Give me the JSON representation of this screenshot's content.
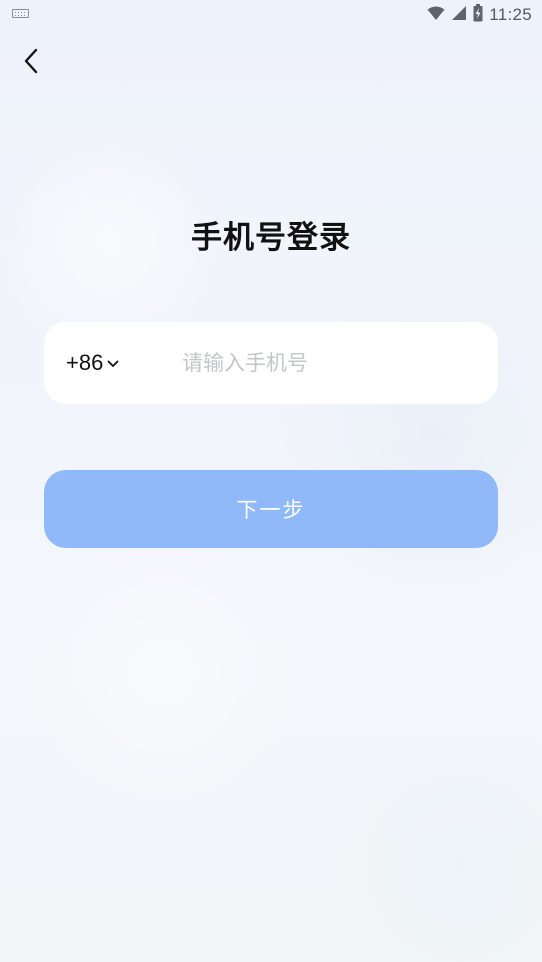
{
  "status_bar": {
    "time": "11:25",
    "icons": [
      "keyboard-icon",
      "wifi-icon",
      "cellular-signal-icon",
      "battery-charging-icon"
    ]
  },
  "nav": {
    "back_icon": "chevron-left-icon"
  },
  "page": {
    "title": "手机号登录"
  },
  "phone_form": {
    "country_code": "+86",
    "country_code_icon": "chevron-down-icon",
    "phone_value": "",
    "phone_placeholder": "请输入手机号"
  },
  "actions": {
    "next_label": "下一步"
  },
  "colors": {
    "accent_button": "#8fb9f9",
    "background": "#eef2fa",
    "card": "#ffffff",
    "placeholder": "#c3c5c9"
  }
}
